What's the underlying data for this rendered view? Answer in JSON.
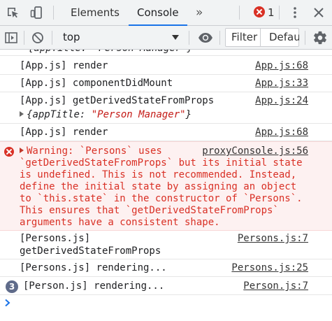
{
  "tabbar": {
    "tabs": [
      {
        "label": "Elements",
        "active": false
      },
      {
        "label": "Console",
        "active": true
      }
    ],
    "more_tabs_glyph": "»",
    "error_count": "1",
    "icons": [
      "inspect-element-icon",
      "device-toolbar-icon",
      "error-icon",
      "more-vert-icon",
      "close-icon"
    ]
  },
  "toolbar": {
    "context": "top",
    "filter_label": "Filter",
    "levels_label": "Defau",
    "icons": [
      "sidebar-toggle-icon",
      "clear-console-icon",
      "dropdown-arrow-icon",
      "eye-icon",
      "gear-icon"
    ]
  },
  "console": {
    "clipped_top": "{appTitle: \"Person Manager\"}",
    "messages": [
      {
        "text": "[App.js] render",
        "source": "App.js:68"
      },
      {
        "text": "[App.js] componentDidMount",
        "source": "App.js:33"
      },
      {
        "text": "[App.js] getDerivedStateFromProps",
        "source": "App.js:24",
        "object_key": "appTitle",
        "object_value": "\"Person Manager\""
      },
      {
        "text": "[App.js] render",
        "source": "App.js:68"
      },
      {
        "level": "error",
        "source": "proxyConsole.js:56",
        "lines": [
          "Warning: `Persons` uses",
          "`getDerivedStateFromProps` but its initial state",
          "is undefined. This is not recommended. Instead,",
          "define the initial state by assigning an object",
          "to `this.state` in the constructor of `Persons`.",
          "This ensures that `getDerivedStateFromProps`",
          "arguments have a consistent shape."
        ]
      },
      {
        "lines": [
          "[Persons.js]",
          "getDerivedStateFromProps"
        ],
        "source": "Persons.js:7"
      },
      {
        "text": "[Persons.js] rendering...",
        "source": "Persons.js:25"
      },
      {
        "text": "[Person.js] rendering...",
        "source": "Person.js:7",
        "repeat_count": "3"
      }
    ],
    "prompt_glyph": "›"
  },
  "colors": {
    "toolbar_bg": "#f1f3f4",
    "accent": "#1a73e8",
    "error_red": "#d93025",
    "error_bg": "#fdf1f1",
    "repeat_badge": "#5f6b8a"
  }
}
